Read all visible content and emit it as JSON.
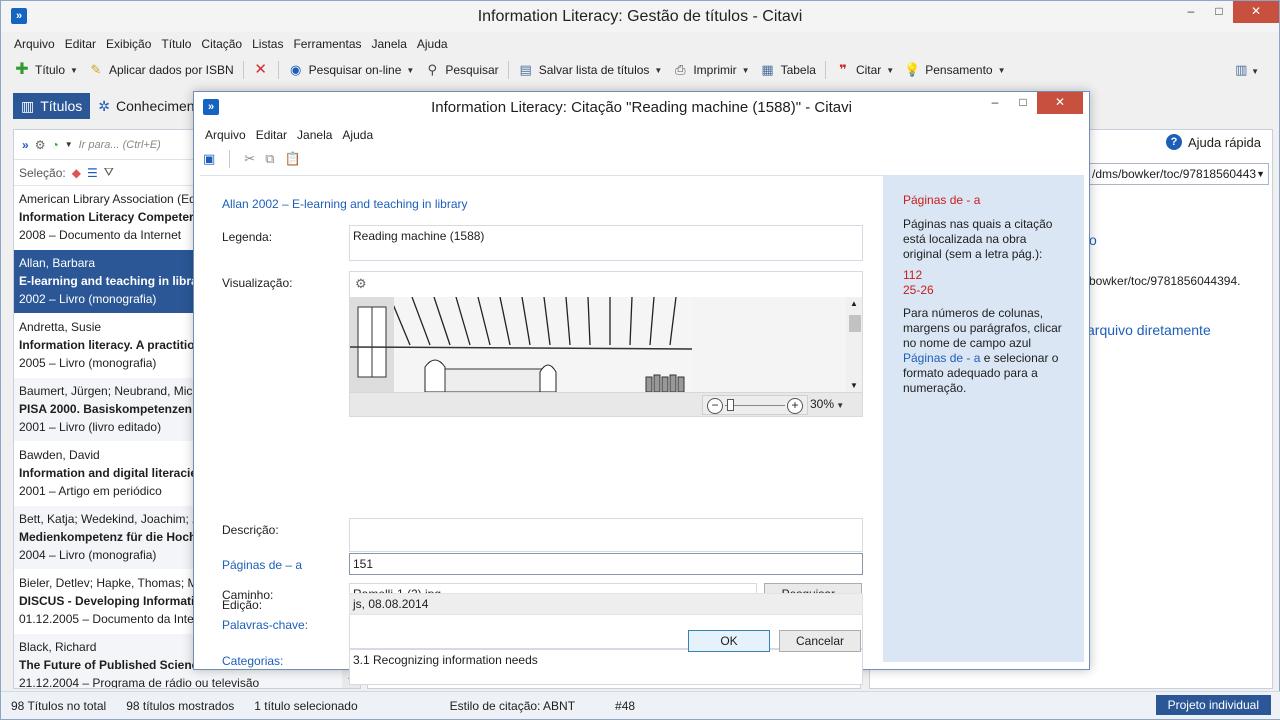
{
  "main": {
    "title": "Information Literacy: Gestão de títulos - Citavi",
    "app_icon": "»",
    "window_controls": {
      "minimize": "–",
      "maximize": "□",
      "close": "✕"
    },
    "menu": [
      "Arquivo",
      "Editar",
      "Exibição",
      "Título",
      "Citação",
      "Listas",
      "Ferramentas",
      "Janela",
      "Ajuda"
    ],
    "toolbar": {
      "titulo": "Título",
      "isbn": "Aplicar dados por ISBN",
      "pesquisar_online": "Pesquisar on-line",
      "pesquisar": "Pesquisar",
      "salvar_lista": "Salvar lista de títulos",
      "imprimir": "Imprimir",
      "tabela": "Tabela",
      "citar": "Citar",
      "pensamento": "Pensamento"
    },
    "tabs": {
      "titulos": "Títulos",
      "conhecimento": "Conhecimen"
    },
    "left_search_placeholder": "Ir para... (Ctrl+E)",
    "selection_label": "Seleção:",
    "help": "Ajuda rápida",
    "url_box": "/dms/bowker/toc/97818560443",
    "right_fragments": {
      "f1": "o",
      "f2": "bowker/toc/9781856044394.",
      "f3": "arquivo diretamente"
    },
    "status": {
      "total": "98 Títulos no total",
      "shown": "98 títulos mostrados",
      "selected": "1 título selecionado",
      "style": "Estilo de citação: ABNT",
      "num": "#48",
      "project": "Projeto individual"
    }
  },
  "refs": [
    {
      "author": "American Library Association (Ed",
      "title": "Information Literacy Competer",
      "meta": "2008 – Documento da Internet"
    },
    {
      "author": "Allan, Barbara",
      "title": "E-learning and teaching in librar",
      "meta": "2002 – Livro (monografia)"
    },
    {
      "author": "Andretta, Susie",
      "title": "Information literacy. A practitio",
      "meta": "2005 – Livro (monografia)"
    },
    {
      "author": "Baumert, Jürgen; Neubrand, Mich",
      "title": "PISA 2000. Basiskompetenzen v",
      "meta": "2001 – Livro (livro editado)"
    },
    {
      "author": "Bawden, David",
      "title": "Information and digital literacie",
      "meta": "2001 – Artigo em periódico"
    },
    {
      "author": "Bett, Katja; Wedekind, Joachim; Z",
      "title": "Medienkompetenz für die Hoch",
      "meta": "2004 – Livro (monografia)"
    },
    {
      "author": "Bieler, Detlev; Hapke, Thomas; M",
      "title": "DISCUS - Developing Informati",
      "meta": "01.12.2005 – Documento da Inte"
    },
    {
      "author": "Black, Richard",
      "title": "The Future of Published Science",
      "meta": "21.12.2004 – Programa de rádio ou televisão"
    }
  ],
  "dialog": {
    "title": "Information Literacy: Citação \"Reading machine (1588)\" - Citavi",
    "menu": [
      "Arquivo",
      "Editar",
      "Janela",
      "Ajuda"
    ],
    "source": "Allan 2002 – E-learning and teaching in library",
    "labels": {
      "legenda": "Legenda:",
      "visualizacao": "Visualização:",
      "descricao": "Descrição:",
      "paginas": "Páginas de – a",
      "caminho": "Caminho:",
      "palavras": "Palavras-chave:",
      "categorias": "Categorias:",
      "edicao": "Edição:"
    },
    "values": {
      "legenda": "Reading machine (1588)",
      "paginas": "151",
      "caminho": "Ramelli-1 (2).jpg",
      "categorias": "3.1 Recognizing information needs",
      "edicao": "js, 08.08.2014",
      "zoom": "30%"
    },
    "buttons": {
      "pesquisar": "Pesquisar...",
      "ok": "OK",
      "cancel": "Cancelar"
    },
    "side": {
      "heading": "Páginas de - a",
      "p1": "Páginas nas quais a citação está localizada na obra original (sem a letra pág.):",
      "ex1": "112",
      "ex2": "25-26",
      "p2a": "Para números de colunas, margens ou parágrafos, clicar no nome de campo azul",
      "p2link": "Páginas de - a",
      "p2b": "e selecionar o formato adequado para a numeração."
    }
  },
  "colors": {
    "accent": "#2b5797",
    "link": "#1d5fb8",
    "side_panel": "#dbe6f5",
    "hint_red": "#c81e1e",
    "close": "#c7503f"
  }
}
